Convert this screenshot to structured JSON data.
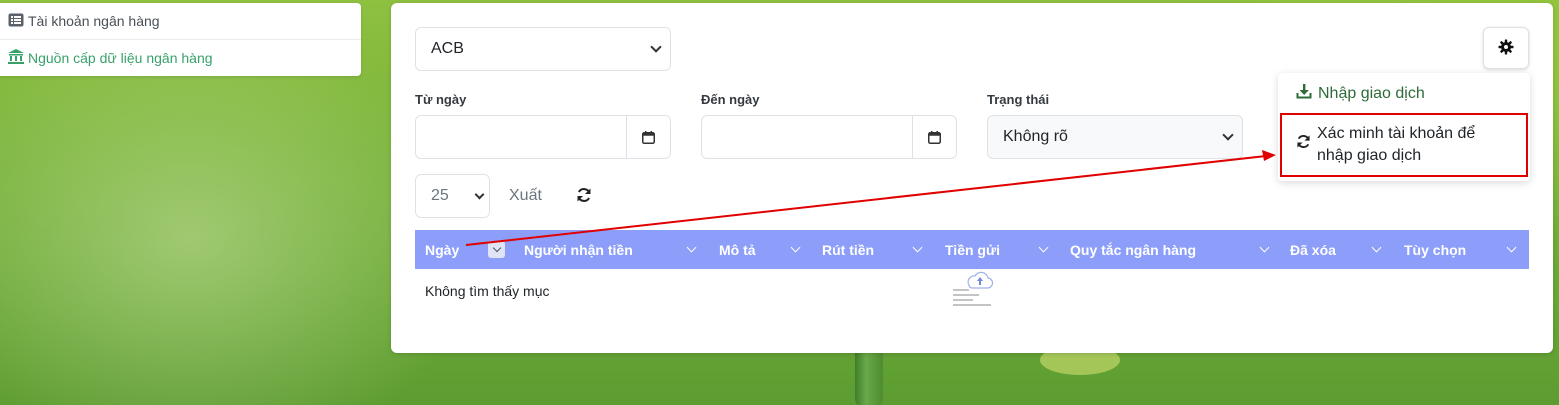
{
  "sidebar": {
    "items": [
      {
        "label": "Tài khoản ngân hàng",
        "icon": "list-icon"
      },
      {
        "label": "Nguồn cấp dữ liệu ngân hàng",
        "icon": "bank-icon"
      }
    ]
  },
  "filters": {
    "bank_select": "ACB",
    "from_date_label": "Từ ngày",
    "to_date_label": "Đến ngày",
    "status_label": "Trạng thái",
    "status_select": "Không rõ"
  },
  "toolbar": {
    "per_page": "25",
    "export_label": "Xuất"
  },
  "table": {
    "columns": [
      "Ngày",
      "Người nhận tiền",
      "Mô tả",
      "Rút tiền",
      "Tiền gửi",
      "Quy tắc ngân hàng",
      "Đã xóa",
      "Tùy chọn"
    ],
    "empty_message": "Không tìm thấy mục"
  },
  "menu": {
    "import_label": "Nhập giao dịch",
    "verify_label_line1": "Xác minh tài khoản để",
    "verify_label_line2": "nhập giao dịch"
  },
  "colors": {
    "table_header": "#8c9ef9",
    "active_sidebar": "#38a169",
    "highlight": "#e00000",
    "import_text": "#2f6b3a"
  }
}
